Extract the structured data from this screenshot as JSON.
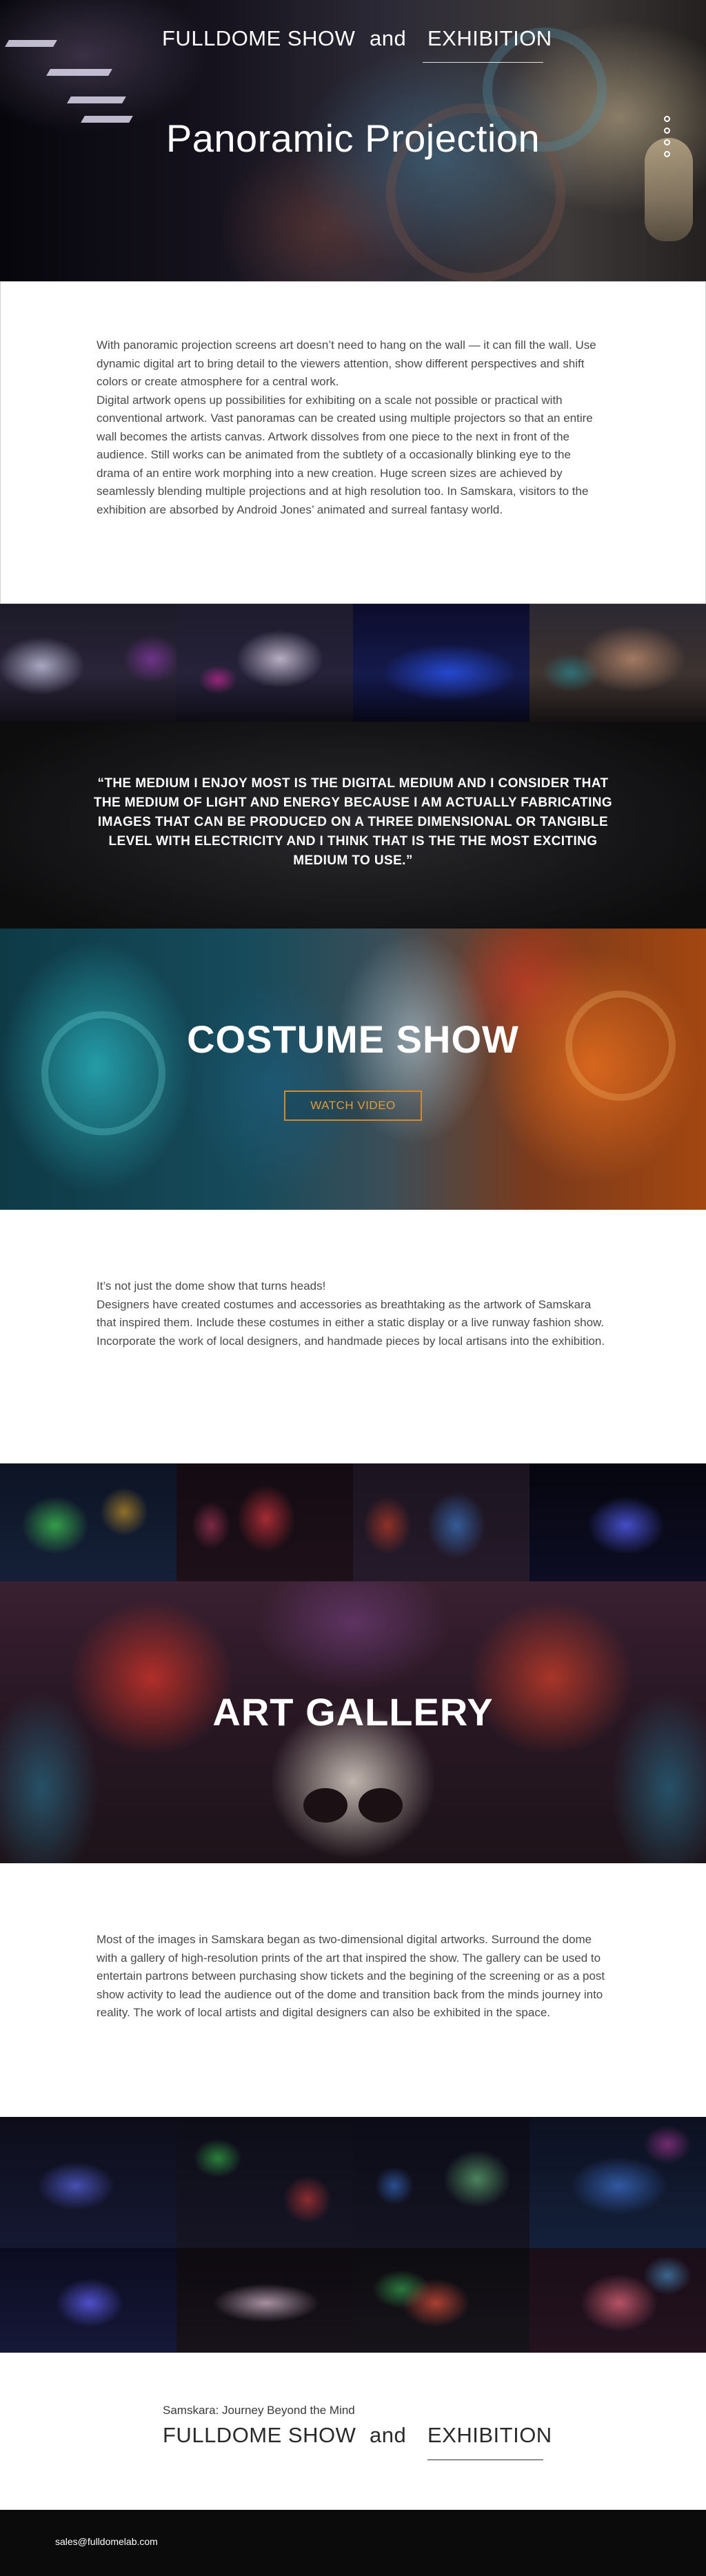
{
  "header": {
    "link_left": "FULLDOME SHOW",
    "and": "and",
    "link_right": "EXHIBITION"
  },
  "hero": {
    "title": "Panoramic Projection"
  },
  "section_nav": {
    "dots": 4
  },
  "panoramic": {
    "paragraphs": [
      "With panoramic projection screens art doesn’t need to hang on the wall — it can fill the wall. Use dynamic digital art to bring detail to the viewers attention, show different perspectives and shift colors or create atmosphere for a central work.",
      "Digital artwork opens up possibilities for exhibiting on a scale not possible or practical with conventional artwork. Vast panoramas can be created using multiple projectors so that an entire wall becomes the artists canvas. Artwork dissolves from one piece to the next in front of the audience. Still works can be animated from the subtlety of a occasionally blinking eye to the drama of an entire work morphing into a new creation. Huge screen sizes are achieved by seamlessly blending multiple projections and at high resolution too. In Samskara, visitors to the exhibition are absorbed by Android Jones’ animated and surreal fantasy world."
    ]
  },
  "quote": {
    "text": "“THE MEDIUM I ENJOY MOST IS THE DIGITAL MEDIUM AND I CONSIDER THAT THE MEDIUM OF LIGHT AND ENERGY BECAUSE I AM ACTUALLY FABRICATING IMAGES THAT CAN BE PRODUCED ON A THREE DIMENSIONAL OR TANGIBLE LEVEL WITH ELECTRICITY AND I THINK THAT IS THE THE MOST EXCITING MEDIUM TO USE.”"
  },
  "costume": {
    "title": "COSTUME SHOW",
    "button": "WATCH VIDEO",
    "paragraphs": [
      "It’s not just the dome show that turns heads!",
      "Designers have created costumes and accessories as breathtaking as the artwork of Samskara that inspired them. Include these costumes in either a static display or a live runway fashion show.",
      "Incorporate the work of local designers, and handmade pieces by local artisans into the exhibition."
    ]
  },
  "gallery": {
    "title": "ART GALLERY",
    "paragraphs": [
      "Most of the images in Samskara began as two-dimensional digital artworks. Surround the dome with a gallery of high-resolution prints of the art that inspired the show. The gallery can be used to entertain partrons between purchasing show tickets and the begining of the screening or as a post show activity to lead the audience out of the dome and transition back from the minds journey into reality. The work of local artists and digital designers can also be exhibited in the space."
    ]
  },
  "footer": {
    "subtitle": "Samskara: Journey Beyond the Mind",
    "link_left": "FULLDOME SHOW",
    "and": "and",
    "link_right": "EXHIBITION",
    "email": "sales@fulldomelab.com"
  }
}
